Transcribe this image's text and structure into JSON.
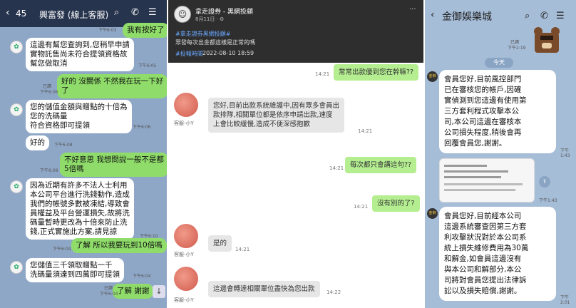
{
  "left_chat": {
    "header": {
      "back_icon": "‹",
      "unread": "45",
      "title": "興富發 (線上客服)"
    },
    "messages": [
      {
        "side": "right",
        "text": "我有按好了",
        "time": "下午6:03"
      },
      {
        "side": "left",
        "text": "這邊有幫您查詢到,您稍早申請\n實物託售尚未符合提領資格故\n幫您做取消",
        "time": "下午6:05"
      },
      {
        "side": "right",
        "text": "好的 沒關係 不然我在玩一下好\n了",
        "time": "下午6:06"
      },
      {
        "side": "left",
        "text": "您的儲值金額與贈點的十倍為\n您的洗碼量\n符合資格即可提領",
        "time": "下午6:06"
      },
      {
        "side": "left",
        "text": "好的",
        "time": "下午6:08"
      },
      {
        "side": "right",
        "text": "不好意思 我想問說一般不是都\n5倍嗎",
        "time": "下午6:09"
      },
      {
        "side": "left",
        "text": "因為近期有許多不法人士利用\n本公司平台進行洗錢動作,造成\n我們的帳號多數被凍結,導致會\n員權益及平台營運損失,故將洗\n碼量暫時更改為十倍來防止洗\n錢,正式實施此方案,請見諒",
        "time": "下午6:10"
      },
      {
        "side": "right",
        "text": "了解 所以我要玩到10倍嗎",
        "time": "下午6:04"
      },
      {
        "side": "left",
        "text": "您儲值三千領取贈點一千\n洗碼量須達到四萬即可提領",
        "time": "下午6:04"
      },
      {
        "side": "right",
        "text": "了解 謝謝",
        "time": "下午6:04"
      }
    ],
    "read_label": "已讀"
  },
  "middle_chat": {
    "post": {
      "name": "拿走證券 - 黑網投顧",
      "date": "8月11日 · ⚙",
      "tag1": "#拿走證券黑網投顧#",
      "text1": "眾發每次出金都這樣是正常的嗎",
      "tag2": "#投報時間",
      "date2": "2022-08-10 18:59"
    },
    "messages": [
      {
        "side": "right",
        "text": "常常出款優到您在幹嘛??",
        "time": "14:21"
      },
      {
        "side": "left",
        "text": "您好,目前出款系統維護中,因有眾多會員出\n款排隊,相關單位都是依序申請出款,速度\n上會比較緩慢,造成不便深感抱歉",
        "time": "14:21",
        "name": "客服-小Y"
      },
      {
        "side": "right",
        "text": "每次都只會講這句??",
        "time": "14:21"
      },
      {
        "side": "right",
        "text": "沒有別的了?",
        "time": "14:21"
      },
      {
        "side": "left",
        "text": "是的",
        "time": "14:21",
        "name": "客服-小Y"
      },
      {
        "side": "left",
        "text": "這邊會轉達相關單位盡快為您出款",
        "time": "14:22",
        "name": "客服-小Y"
      }
    ]
  },
  "right_chat": {
    "header": {
      "back_icon": "‹",
      "title": "金御娛樂城"
    },
    "read": "已讀",
    "time_top": "下午2:19",
    "today": "今天",
    "avatar_label": "金御",
    "messages": [
      {
        "text": "會員您好,目前風控部門\n已在審核您的帳戶,因確\n實偵測到您這邊有使用第\n三方套利程式攻擊本公\n司,本公司這邊在審核本\n公司損失程度,稍後會再\n回覆會員您,謝謝。",
        "time": "下午1:43"
      },
      {
        "text": "會員您好,目前經本公司\n這邊系統審查因第三方套\n利攻擊狀況對於本公司系\n統上損失維修費用為30萬\n和解金,如會員這邊沒有\n與本公司和解部分,本公\n司將對會員您提出法律訴\n訟以及損失賠償,謝謝。",
        "time": "下午2:01"
      }
    ],
    "image_time": "下午1:43"
  },
  "colors": {
    "left_bg": "#8fa7c7",
    "left_header": "#27344d",
    "green": "#8fdc6a",
    "right_bg": "#a6bdd8",
    "mid_green": "#b4ee90"
  }
}
